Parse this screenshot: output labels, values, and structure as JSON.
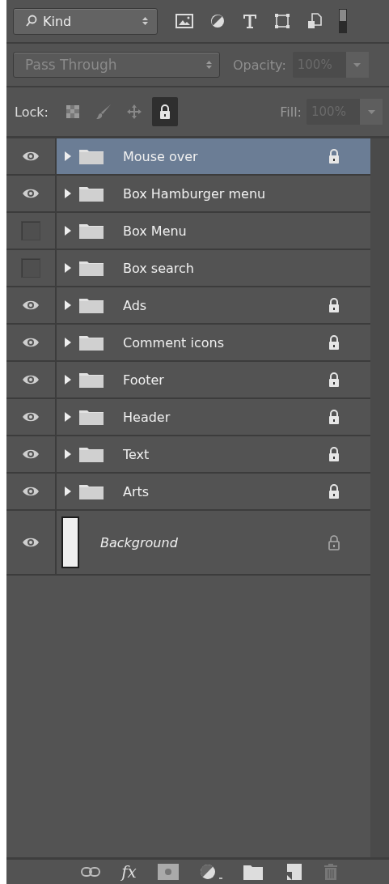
{
  "filter": {
    "label": "Kind"
  },
  "blend_mode": {
    "value": "Pass Through"
  },
  "opacity": {
    "label": "Opacity:",
    "value": "100%"
  },
  "lock": {
    "label": "Lock:",
    "options": [
      {
        "kind": "pixels",
        "selected": false
      },
      {
        "kind": "paint",
        "selected": false
      },
      {
        "kind": "position",
        "selected": false
      },
      {
        "kind": "all",
        "selected": true
      }
    ]
  },
  "fill": {
    "label": "Fill:",
    "value": "100%"
  },
  "footer": {
    "style_button": "fx"
  },
  "layers": [
    {
      "name": "Mouse over",
      "kind": "group",
      "visible": true,
      "locked": true,
      "selected": true
    },
    {
      "name": "Box Hamburger menu",
      "kind": "group",
      "visible": true,
      "locked": false,
      "selected": false
    },
    {
      "name": "Box Menu",
      "kind": "group",
      "visible": false,
      "locked": false,
      "selected": false
    },
    {
      "name": "Box search",
      "kind": "group",
      "visible": false,
      "locked": false,
      "selected": false
    },
    {
      "name": "Ads",
      "kind": "group",
      "visible": true,
      "locked": true,
      "selected": false
    },
    {
      "name": "Comment icons",
      "kind": "group",
      "visible": true,
      "locked": true,
      "selected": false
    },
    {
      "name": "Footer",
      "kind": "group",
      "visible": true,
      "locked": true,
      "selected": false
    },
    {
      "name": "Header",
      "kind": "group",
      "visible": true,
      "locked": true,
      "selected": false
    },
    {
      "name": "Text",
      "kind": "group",
      "visible": true,
      "locked": true,
      "selected": false
    },
    {
      "name": "Arts",
      "kind": "group",
      "visible": true,
      "locked": true,
      "selected": false
    },
    {
      "name": "Background",
      "kind": "background",
      "visible": true,
      "locked": true,
      "selected": false
    }
  ]
}
